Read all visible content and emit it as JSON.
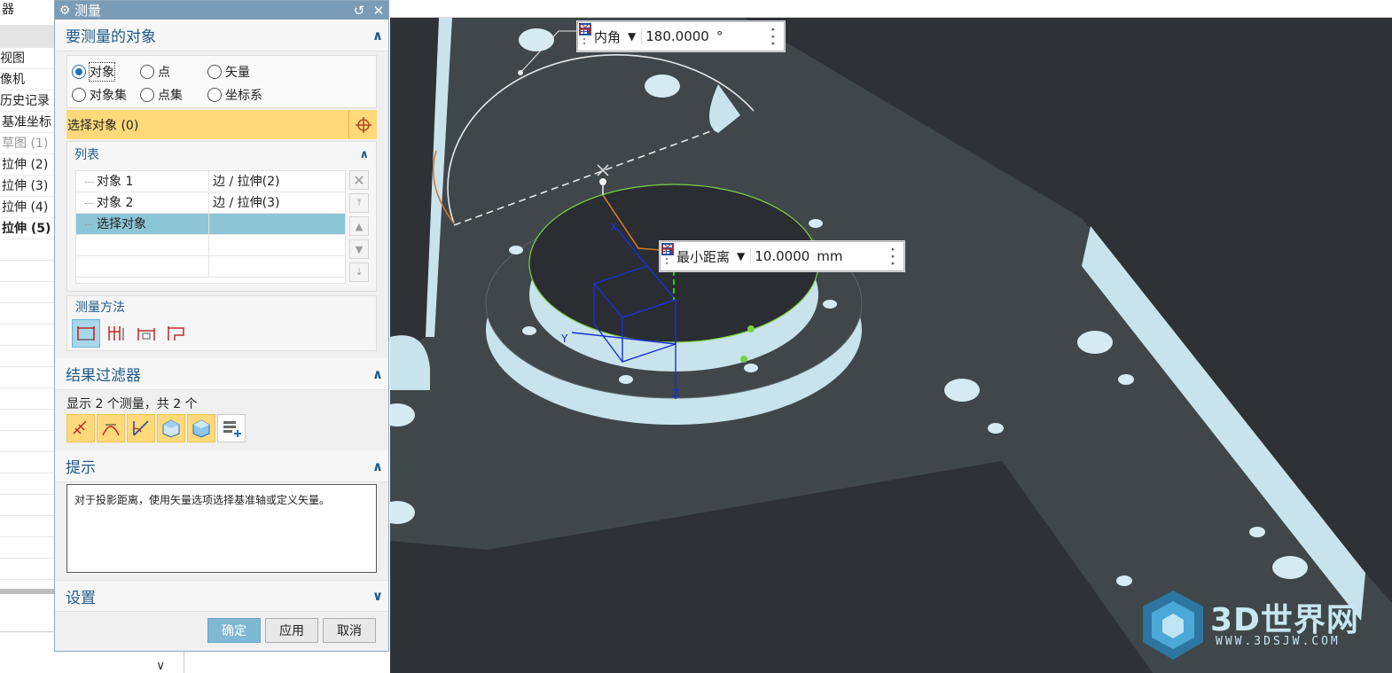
{
  "navigator": {
    "title_fragment": "器",
    "items": [
      {
        "label": "视图"
      },
      {
        "label": "像机"
      },
      {
        "label": "历史记录"
      },
      {
        "label": "基准坐标"
      },
      {
        "label": "草图 (1)"
      },
      {
        "label": "拉伸 (2)"
      },
      {
        "label": "拉伸 (3)"
      },
      {
        "label": "拉伸 (4)"
      },
      {
        "label": "拉伸 (5)"
      }
    ]
  },
  "dialog": {
    "title": "测量",
    "objects_section": {
      "title": "要测量的对象",
      "radios": [
        {
          "label": "对象",
          "checked": true
        },
        {
          "label": "点",
          "checked": false
        },
        {
          "label": "矢量",
          "checked": false
        },
        {
          "label": "对象集",
          "checked": false
        },
        {
          "label": "点集",
          "checked": false
        },
        {
          "label": "坐标系",
          "checked": false
        }
      ],
      "select_label": "选择对象 (0)",
      "list_title": "列表",
      "list_rows": [
        {
          "name": "对象 1",
          "value": "边 / 拉伸(2)"
        },
        {
          "name": "对象 2",
          "value": "边 / 拉伸(3)"
        },
        {
          "name": "选择对象",
          "value": ""
        }
      ],
      "method_title": "测量方法"
    },
    "filter_section": {
      "title": "结果过滤器",
      "summary": "显示 2 个测量，共 2 个"
    },
    "hint_section": {
      "title": "提示",
      "text": "对于投影距离，使用矢量选项选择基准轴或定义矢量。"
    },
    "settings_section": {
      "title": "设置"
    },
    "buttons": {
      "ok": "确定",
      "apply": "应用",
      "cancel": "取消"
    }
  },
  "viewport": {
    "angle_box": {
      "type": "内角",
      "value": "180.0000",
      "unit": "°"
    },
    "distance_box": {
      "type": "最小距离",
      "value": "10.0000",
      "unit": "mm"
    },
    "axis_labels": {
      "x": "X",
      "y": "Y",
      "z": "Z"
    },
    "watermark": {
      "brand": "3D世界网",
      "url": "WWW.3DSJW.COM"
    },
    "colors": {
      "background": "#2e3135",
      "plate_top": "#3f474a",
      "plate_side": "#c9e3ec",
      "csys": "#1a2fd6",
      "measure_line": "#d07a2a",
      "highlight_edge": "#7bd04a"
    }
  },
  "icons": [
    "gear-icon",
    "reset-icon",
    "close-icon",
    "collapse-icon",
    "crosshair-icon",
    "delete-icon",
    "move-top-icon",
    "move-up-icon",
    "move-down-icon",
    "move-bottom-icon"
  ]
}
